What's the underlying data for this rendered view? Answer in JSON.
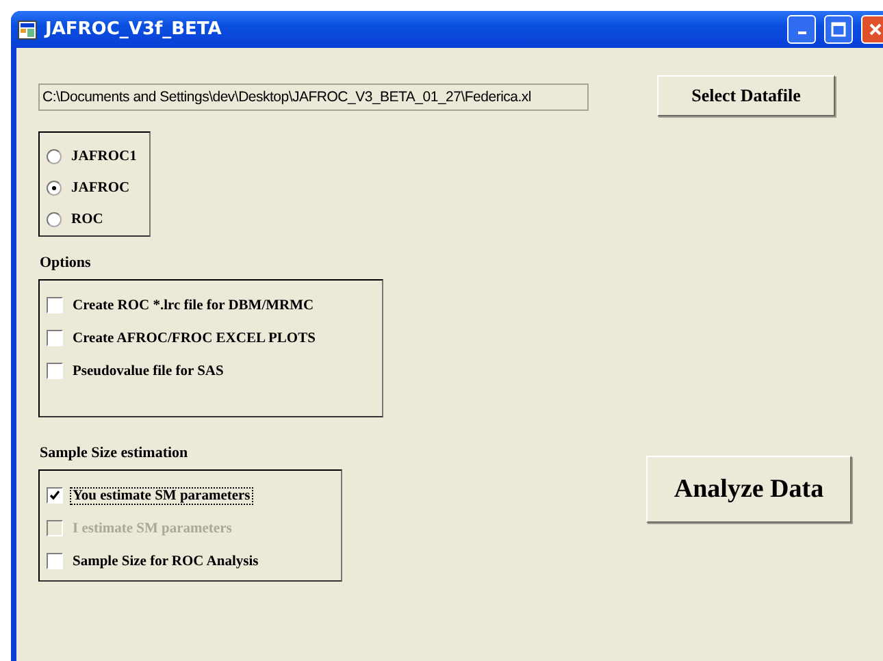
{
  "window": {
    "title": "JAFROC_V3f_BETA"
  },
  "file_path": {
    "value": "C:\\Documents and Settings\\dev\\Desktop\\JAFROC_V3_BETA_01_27\\Federica.xl"
  },
  "select_button": "Select Datafile",
  "analysis_mode": [
    {
      "label": "JAFROC1",
      "selected": false
    },
    {
      "label": "JAFROC",
      "selected": true
    },
    {
      "label": "ROC",
      "selected": false
    }
  ],
  "options": {
    "title": "Options",
    "items": [
      {
        "label": "Create ROC *.lrc file for DBM/MRMC",
        "checked": false
      },
      {
        "label": "Create AFROC/FROC EXCEL PLOTS",
        "checked": false
      },
      {
        "label": "Pseudovalue file for SAS",
        "checked": false
      }
    ]
  },
  "sample_size": {
    "title": "Sample Size estimation",
    "items": [
      {
        "label": "You estimate SM parameters",
        "checked": true,
        "disabled": false,
        "focused": true
      },
      {
        "label": "I estimate SM parameters",
        "checked": false,
        "disabled": true,
        "focused": false
      },
      {
        "label": "Sample Size for ROC Analysis",
        "checked": false,
        "disabled": false,
        "focused": false
      }
    ]
  },
  "analyze_button": "Analyze Data"
}
